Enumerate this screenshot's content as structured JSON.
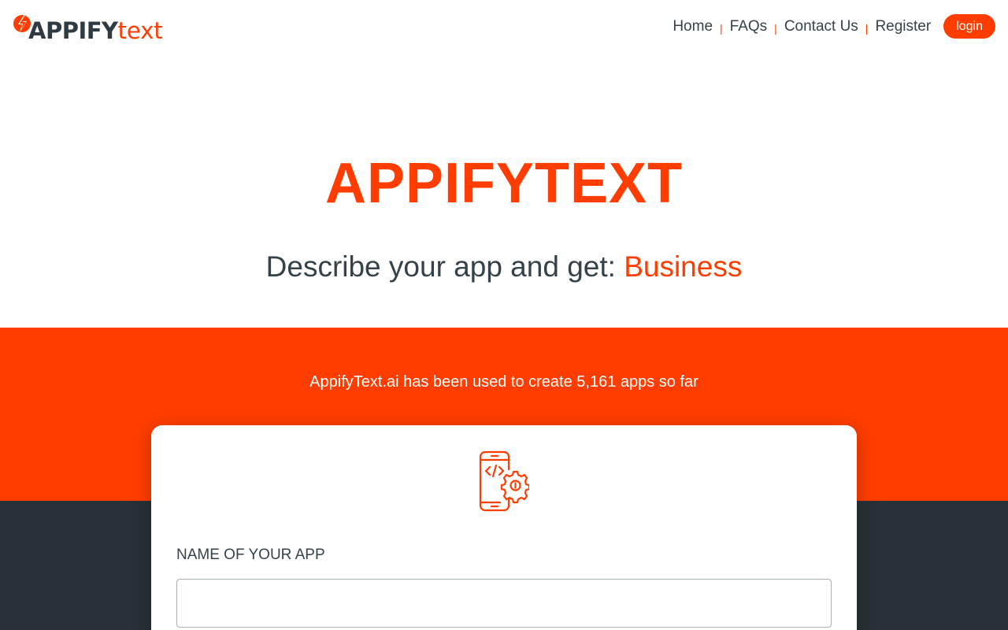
{
  "header": {
    "logo": {
      "bold": "APPIFY",
      "light": "text"
    },
    "nav": [
      {
        "label": "Home"
      },
      {
        "label": "FAQs"
      },
      {
        "label": "Contact Us"
      },
      {
        "label": "Register"
      }
    ],
    "separator": "|",
    "login_label": "login"
  },
  "hero": {
    "title": "APPIFYTEXT",
    "subtitle_prefix": "Describe your app and get:",
    "subtitle_highlight": "Business"
  },
  "stats": {
    "text": "AppifyText.ai has been used to create 5,161 apps so far"
  },
  "form": {
    "name_label": "NAME OF YOUR APP",
    "name_value": "",
    "name_placeholder": ""
  },
  "colors": {
    "accent": "#ff3d00",
    "dark": "#263238",
    "text": "#35424a"
  },
  "icons": {
    "logo": "lightning-bolt-icon",
    "card": "mobile-code-gear-icon"
  }
}
